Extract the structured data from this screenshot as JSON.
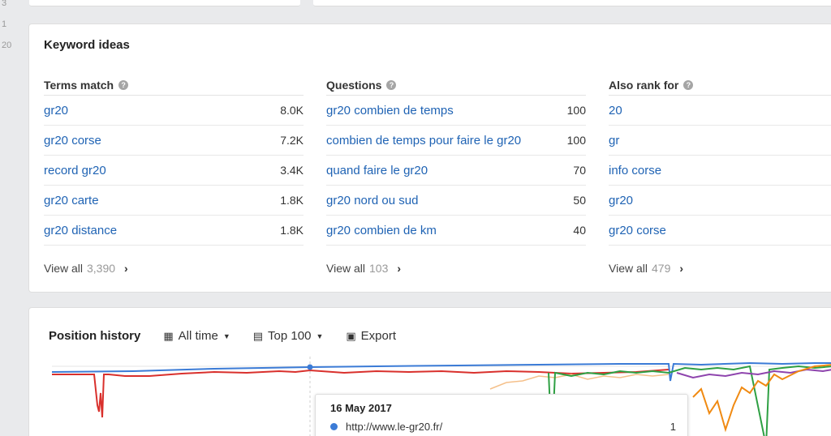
{
  "gutter": [
    "3",
    "1",
    "20"
  ],
  "keyword_ideas": {
    "title": "Keyword ideas",
    "columns": [
      {
        "header": "Terms match",
        "rows": [
          {
            "keyword": "gr20",
            "volume": "8.0K"
          },
          {
            "keyword": "gr20 corse",
            "volume": "7.2K"
          },
          {
            "keyword": "record gr20",
            "volume": "3.4K"
          },
          {
            "keyword": "gr20 carte",
            "volume": "1.8K"
          },
          {
            "keyword": "gr20 distance",
            "volume": "1.8K"
          }
        ],
        "view_all_label": "View all",
        "view_all_count": "3,390"
      },
      {
        "header": "Questions",
        "rows": [
          {
            "keyword": "gr20 combien de temps",
            "volume": "100"
          },
          {
            "keyword": "combien de temps pour faire le gr20",
            "volume": "100"
          },
          {
            "keyword": "quand faire le gr20",
            "volume": "70"
          },
          {
            "keyword": "gr20 nord ou sud",
            "volume": "50"
          },
          {
            "keyword": "gr20 combien de km",
            "volume": "40"
          }
        ],
        "view_all_label": "View all",
        "view_all_count": "103"
      },
      {
        "header": "Also rank for",
        "rows": [
          {
            "keyword": "20",
            "volume": ""
          },
          {
            "keyword": "gr",
            "volume": ""
          },
          {
            "keyword": "info corse",
            "volume": ""
          },
          {
            "keyword": "gr20",
            "volume": ""
          },
          {
            "keyword": "gr20 corse",
            "volume": ""
          }
        ],
        "view_all_label": "View all",
        "view_all_count": "479"
      }
    ]
  },
  "position_history": {
    "title": "Position history",
    "range_label": "All time",
    "top_label": "Top 100",
    "export_label": "Export",
    "tooltip": {
      "date": "16 May 2017",
      "url": "http://www.le-gr20.fr/",
      "position": "1"
    },
    "colors": {
      "blue": "#3b7bd6",
      "red": "#d9302c",
      "green": "#2ea043",
      "orange": "#f08a12",
      "purple": "#8e44ad",
      "light_orange": "#f5c08a"
    }
  }
}
